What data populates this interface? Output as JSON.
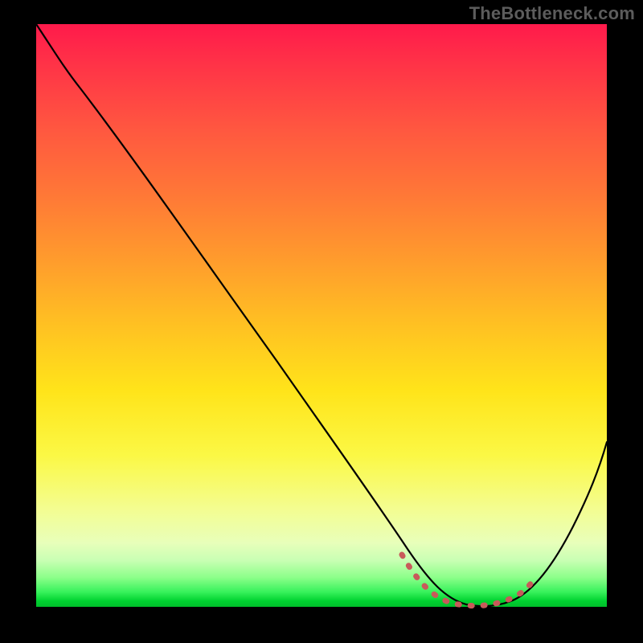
{
  "watermark": "TheBottleneck.com",
  "chart_data": {
    "type": "line",
    "title": "",
    "xlabel": "",
    "ylabel": "",
    "xlim": [
      0,
      100
    ],
    "ylim": [
      0,
      100
    ],
    "grid": false,
    "x": [
      0,
      3,
      8,
      15,
      25,
      35,
      45,
      55,
      62,
      67,
      70,
      73,
      76,
      79,
      82,
      86,
      90,
      95,
      100
    ],
    "y": [
      100,
      96,
      90,
      82,
      70,
      58,
      46,
      34,
      24,
      15,
      9,
      4,
      1,
      0,
      0,
      1,
      6,
      15,
      28
    ],
    "series": [
      {
        "name": "bottleneck-curve",
        "color": "#000000"
      }
    ],
    "highlight_region": {
      "name": "optimal-zone",
      "color": "#c85a5a",
      "x": [
        64,
        86
      ],
      "y": [
        2,
        2
      ]
    },
    "background_gradient_stops": [
      {
        "pos": 0,
        "color": "#ff1a4b"
      },
      {
        "pos": 50,
        "color": "#ffc222"
      },
      {
        "pos": 75,
        "color": "#f8fd70"
      },
      {
        "pos": 100,
        "color": "#00be2b"
      }
    ]
  }
}
